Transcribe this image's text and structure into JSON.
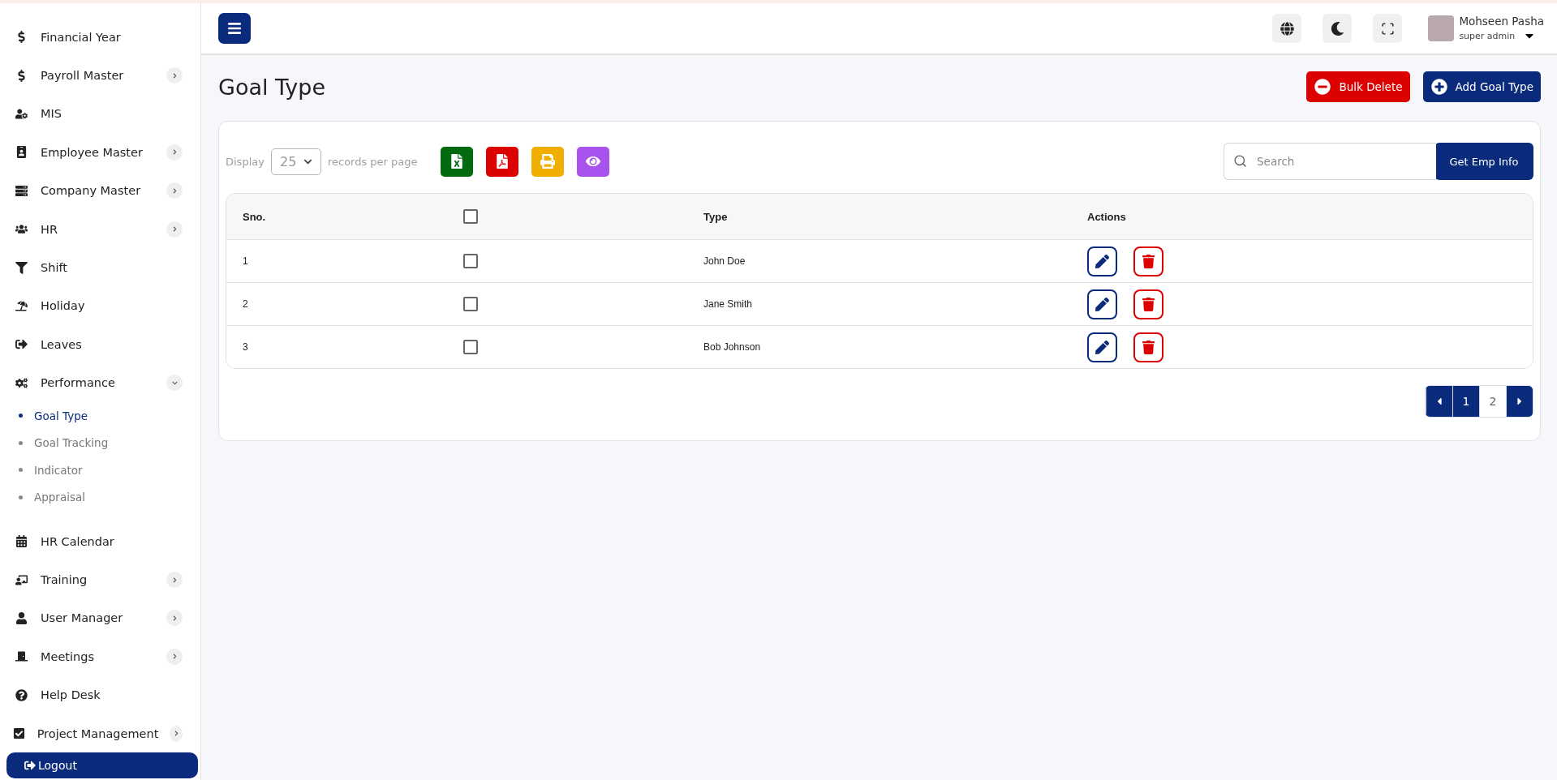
{
  "sidebar": {
    "items": [
      {
        "label": "Financial Year",
        "kind": "link"
      },
      {
        "label": "Payroll Master",
        "kind": "group",
        "expanded": false
      },
      {
        "label": "MIS",
        "kind": "link"
      },
      {
        "label": "Employee Master",
        "kind": "group",
        "expanded": false
      },
      {
        "label": "Company Master",
        "kind": "group",
        "expanded": false
      },
      {
        "label": "HR",
        "kind": "group",
        "expanded": false
      },
      {
        "label": "Shift",
        "kind": "link"
      },
      {
        "label": "Holiday",
        "kind": "link"
      },
      {
        "label": "Leaves",
        "kind": "link"
      },
      {
        "label": "Performance",
        "kind": "group",
        "expanded": true,
        "children": [
          {
            "label": "Goal Type",
            "selected": true
          },
          {
            "label": "Goal Tracking",
            "selected": false
          },
          {
            "label": "Indicator",
            "selected": false
          },
          {
            "label": "Appraisal",
            "selected": false
          }
        ]
      },
      {
        "label": "HR Calendar",
        "kind": "link"
      },
      {
        "label": "Training",
        "kind": "group",
        "expanded": false
      },
      {
        "label": "User Manager",
        "kind": "group",
        "expanded": false
      },
      {
        "label": "Meetings",
        "kind": "group",
        "expanded": false
      },
      {
        "label": "Help Desk",
        "kind": "link"
      },
      {
        "label": "Project Management",
        "kind": "group",
        "expanded": false
      }
    ],
    "logout": "Logout"
  },
  "header": {
    "user_name": "Mohseen Pasha",
    "user_role": "super admin"
  },
  "page": {
    "title": "Goal Type",
    "buttons": [
      {
        "label": "Bulk Delete",
        "kind": "danger"
      },
      {
        "label": "Add Goal Type",
        "kind": "primary"
      }
    ]
  },
  "toolbar": {
    "display_label": "Display",
    "page_size": "25",
    "records_label": "records per page",
    "search": {
      "placeholder": "Search"
    },
    "search_button": "Get Emp Info"
  },
  "table": {
    "columns": [
      "Sno.",
      "",
      "Type",
      "Actions"
    ],
    "header_checked": false,
    "rows": [
      {
        "sno": "1",
        "checked": false,
        "type": "John Doe"
      },
      {
        "sno": "2",
        "checked": false,
        "type": "Jane Smith"
      },
      {
        "sno": "3",
        "checked": false,
        "type": "Bob Johnson"
      }
    ]
  },
  "pagination": {
    "pages": [
      {
        "label": "1",
        "selected": true
      },
      {
        "label": "2",
        "selected": false
      }
    ]
  }
}
